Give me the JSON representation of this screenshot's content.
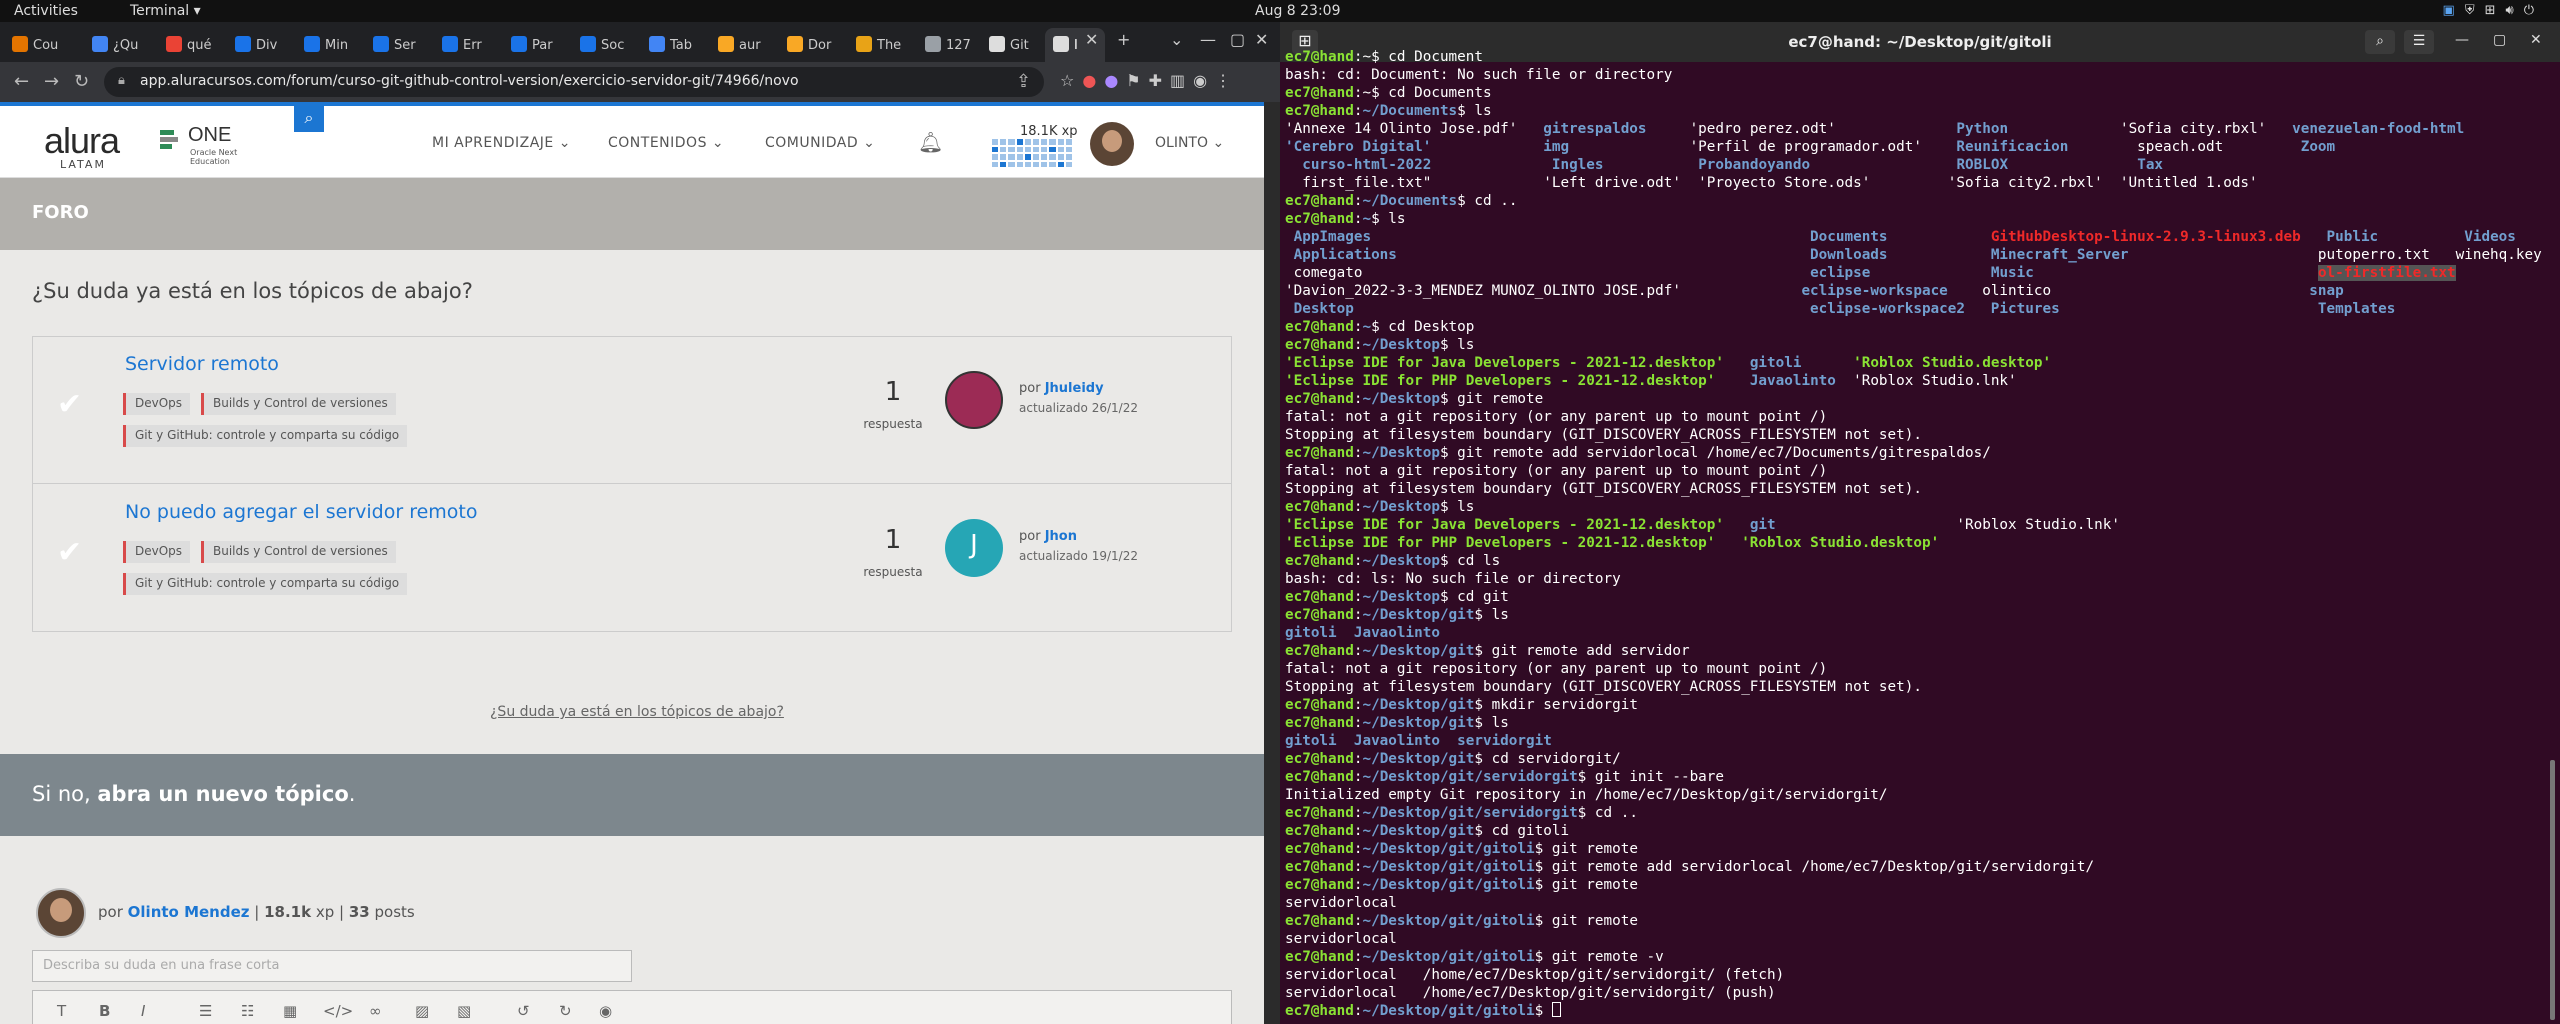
{
  "topbar": {
    "activities": "Activities",
    "app": "Terminal ▾",
    "clock": "Aug 8  23:09"
  },
  "browser": {
    "tabs": [
      {
        "label": "Cou",
        "color": "#e37400"
      },
      {
        "label": "¿Qu",
        "color": "#4285f4"
      },
      {
        "label": "qué",
        "color": "#ea4335"
      },
      {
        "label": "Div",
        "color": "#1a73e8"
      },
      {
        "label": "Min",
        "color": "#1a73e8"
      },
      {
        "label": "Ser",
        "color": "#1a73e8"
      },
      {
        "label": "Err",
        "color": "#1a73e8"
      },
      {
        "label": "Par",
        "color": "#1a73e8"
      },
      {
        "label": "Soc",
        "color": "#1a73e8"
      },
      {
        "label": "Tab",
        "color": "#4285f4"
      },
      {
        "label": "aur",
        "color": "#f9a825"
      },
      {
        "label": "Dor",
        "color": "#f9a825"
      },
      {
        "label": "The",
        "color": "#e8a317"
      },
      {
        "label": "127",
        "color": "#9aa0a6"
      },
      {
        "label": "Git",
        "color": "#ddd"
      },
      {
        "label": "I",
        "color": "#ddd"
      }
    ],
    "url": "app.aluracursos.com/forum/curso-git-github-control-version/exercicio-servidor-git/74966/novo"
  },
  "site": {
    "logo": "alura",
    "logo_sub": "LATAM",
    "one": "ONE",
    "one_sub": "Oracle Next Education",
    "menu": [
      "MI APRENDIZAJE ⌄",
      "CONTENIDOS ⌄",
      "COMUNIDAD ⌄"
    ],
    "xp": "18.1K xp",
    "user": "OLINTO ⌄",
    "foro": "FORO",
    "question": "¿Su duda ya está en los tópicos de abajo?",
    "topics": [
      {
        "title": "Servidor remoto",
        "tags": [
          "DevOps",
          "Builds y Control de versiones",
          "Git y GitHub: controle y comparta su código"
        ],
        "count": "1",
        "resp": "respuesta",
        "by": "Jhuleidy",
        "updated": "actualizado 26/1/22",
        "avatar_color": "#9c2b55"
      },
      {
        "title": "No puedo agregar el servidor remoto",
        "tags": [
          "DevOps",
          "Builds y Control de versiones",
          "Git y GitHub: controle y comparta su código"
        ],
        "count": "1",
        "resp": "respuesta",
        "by": "Jhon",
        "updated": "actualizado 19/1/22",
        "avatar_color": "#26a6b5",
        "initial": "J"
      }
    ],
    "por": "por",
    "dup_link": "¿Su duda ya está en los tópicos de abajo?",
    "new_prefix": "Si no, ",
    "new_bold": "abra un nuevo tópico",
    "new_suffix": ".",
    "composer_author": "Olinto Mendez",
    "composer_xp": "18.1k",
    "composer_xp_unit": "xp",
    "composer_posts": "33",
    "composer_posts_unit": "posts",
    "composer_placeholder": "Describa su duda en una frase corta"
  },
  "terminal": {
    "title": "ec7@hand: ~/Desktop/git/gitoli",
    "lines": [
      [
        [
          "p",
          "ec7@hand"
        ],
        [
          "",
          "~"
        ],
        [
          "",
          "$ cd Document"
        ]
      ],
      [
        [
          "",
          "bash: cd: Document: No such file or directory"
        ]
      ],
      [
        [
          "p",
          "ec7@hand"
        ],
        [
          "",
          "~"
        ],
        [
          "",
          "$ cd Documents"
        ]
      ],
      [
        [
          "p",
          "ec7@hand"
        ],
        [
          "pb",
          "~/Documents"
        ],
        [
          "",
          "$ ls"
        ]
      ],
      [
        [
          "",
          "'Annexe 14 Olinto Jose.pdf'   "
        ],
        [
          "d",
          "gitrespaldos"
        ],
        [
          "",
          "     'pedro perez.odt'              "
        ],
        [
          "d",
          "Python"
        ],
        [
          "",
          "             'Sofia city.rbxl'   "
        ],
        [
          "d",
          "venezuelan-food-html"
        ]
      ],
      [
        [
          "d",
          "'Cerebro Digital'"
        ],
        [
          "",
          "             "
        ],
        [
          "d",
          "img"
        ],
        [
          "",
          "              'Perfil de programador.odt'    "
        ],
        [
          "d",
          "Reunificacion"
        ],
        [
          "",
          "        speach.odt         "
        ],
        [
          "d",
          "Zoom"
        ]
      ],
      [
        [
          "",
          "  "
        ],
        [
          "d",
          "curso-html-2022"
        ],
        [
          "",
          "              "
        ],
        [
          "d",
          "Ingles"
        ],
        [
          "",
          "           "
        ],
        [
          "d",
          "Probandoyando"
        ],
        [
          "",
          "                 "
        ],
        [
          "d",
          "ROBLOX"
        ],
        [
          "",
          "               "
        ],
        [
          "d",
          "Tax"
        ]
      ],
      [
        [
          "",
          "  first_file.txt\"             'Left drive.odt'  'Proyecto Store.ods'         'Sofia city2.rbxl'  'Untitled 1.ods'"
        ]
      ],
      [
        [
          "p",
          "ec7@hand"
        ],
        [
          "pb",
          "~/Documents"
        ],
        [
          "",
          "$ cd .."
        ]
      ],
      [
        [
          "p",
          "ec7@hand"
        ],
        [
          "pb",
          "~"
        ],
        [
          "",
          "$ ls"
        ]
      ],
      [
        [
          "d",
          " AppImages                                                   Documents            "
        ],
        [
          "r",
          "GitHubDesktop-linux-2.9.3-linux3.deb"
        ],
        [
          "",
          "   "
        ],
        [
          "d",
          "Public"
        ],
        [
          "",
          "          "
        ],
        [
          "d",
          "Videos"
        ]
      ],
      [
        [
          "d",
          " Applications                                                Downloads            "
        ],
        [
          "d",
          "Minecraft_Server"
        ],
        [
          "",
          "                      putoperro.txt   winehq.key"
        ]
      ],
      [
        [
          "",
          "",
          " comegato                                                    "
        ],
        [
          "d",
          "eclipse"
        ],
        [
          "",
          "              "
        ],
        [
          "d",
          "Music"
        ],
        [
          "",
          "                                 "
        ],
        [
          "hl",
          "ol-firstfile.txt"
        ]
      ],
      [
        [
          "",
          "'Davion_2022-3-3_MENDEZ MUNOZ_OLINTO JOSE.pdf'              "
        ],
        [
          "d",
          "eclipse-workspace"
        ],
        [
          "",
          "    olintico                              "
        ],
        [
          "d",
          "snap"
        ]
      ],
      [
        [
          "d",
          " Desktop                                                     eclipse-workspace2   Pictures"
        ],
        [
          "",
          "                              "
        ],
        [
          "d",
          "Templates"
        ]
      ],
      [
        [
          "p",
          "ec7@hand"
        ],
        [
          "pb",
          "~"
        ],
        [
          "",
          "$ cd Desktop"
        ]
      ],
      [
        [
          "p",
          "ec7@hand"
        ],
        [
          "pb",
          "~/Desktop"
        ],
        [
          "",
          "$ ls"
        ]
      ],
      [
        [
          "o",
          "'Eclipse IDE for Java Developers - 2021-12.desktop'"
        ],
        [
          "",
          "   "
        ],
        [
          "d",
          "gitoli"
        ],
        [
          "",
          "      "
        ],
        [
          "o",
          "'Roblox Studio.desktop'"
        ]
      ],
      [
        [
          "o",
          "'Eclipse IDE for PHP Developers - 2021-12.desktop'"
        ],
        [
          "",
          "    "
        ],
        [
          "d",
          "Javaolinto"
        ],
        [
          "",
          "  'Roblox Studio.lnk'"
        ]
      ],
      [
        [
          "p",
          "ec7@hand"
        ],
        [
          "pb",
          "~/Desktop"
        ],
        [
          "",
          "$ git remote"
        ]
      ],
      [
        [
          "",
          "fatal: not a git repository (or any parent up to mount point /)"
        ]
      ],
      [
        [
          "",
          "Stopping at filesystem boundary (GIT_DISCOVERY_ACROSS_FILESYSTEM not set)."
        ]
      ],
      [
        [
          "p",
          "ec7@hand"
        ],
        [
          "pb",
          "~/Desktop"
        ],
        [
          "",
          "$ git remote add servidorlocal /home/ec7/Documents/gitrespaldos/"
        ]
      ],
      [
        [
          "",
          "fatal: not a git repository (or any parent up to mount point /)"
        ]
      ],
      [
        [
          "",
          "Stopping at filesystem boundary (GIT_DISCOVERY_ACROSS_FILESYSTEM not set)."
        ]
      ],
      [
        [
          "p",
          "ec7@hand"
        ],
        [
          "pb",
          "~/Desktop"
        ],
        [
          "",
          "$ ls"
        ]
      ],
      [
        [
          "o",
          "'Eclipse IDE for Java Developers - 2021-12.desktop'"
        ],
        [
          "",
          "   "
        ],
        [
          "d",
          "git"
        ],
        [
          "",
          "                     'Roblox Studio.lnk'"
        ]
      ],
      [
        [
          "o",
          "'Eclipse IDE for PHP Developers - 2021-12.desktop'"
        ],
        [
          "",
          "   "
        ],
        [
          "o",
          "'Roblox Studio.desktop'"
        ]
      ],
      [
        [
          "p",
          "ec7@hand"
        ],
        [
          "pb",
          "~/Desktop"
        ],
        [
          "",
          "$ cd ls"
        ]
      ],
      [
        [
          "",
          "bash: cd: ls: No such file or directory"
        ]
      ],
      [
        [
          "p",
          "ec7@hand"
        ],
        [
          "pb",
          "~/Desktop"
        ],
        [
          "",
          "$ cd git"
        ]
      ],
      [
        [
          "p",
          "ec7@hand"
        ],
        [
          "pb",
          "~/Desktop/git"
        ],
        [
          "",
          "$ ls"
        ]
      ],
      [
        [
          "d",
          "gitoli  Javaolinto"
        ]
      ],
      [
        [
          "p",
          "ec7@hand"
        ],
        [
          "pb",
          "~/Desktop/git"
        ],
        [
          "",
          "$ git remote add servidor"
        ]
      ],
      [
        [
          "",
          "fatal: not a git repository (or any parent up to mount point /)"
        ]
      ],
      [
        [
          "",
          "Stopping at filesystem boundary (GIT_DISCOVERY_ACROSS_FILESYSTEM not set)."
        ]
      ],
      [
        [
          "p",
          "ec7@hand"
        ],
        [
          "pb",
          "~/Desktop/git"
        ],
        [
          "",
          "$ mkdir servidorgit"
        ]
      ],
      [
        [
          "p",
          "ec7@hand"
        ],
        [
          "pb",
          "~/Desktop/git"
        ],
        [
          "",
          "$ ls"
        ]
      ],
      [
        [
          "d",
          "gitoli  Javaolinto  servidorgit"
        ]
      ],
      [
        [
          "p",
          "ec7@hand"
        ],
        [
          "pb",
          "~/Desktop/git"
        ],
        [
          "",
          "$ cd servidorgit/"
        ]
      ],
      [
        [
          "p",
          "ec7@hand"
        ],
        [
          "pb",
          "~/Desktop/git/servidorgit"
        ],
        [
          "",
          "$ git init --bare"
        ]
      ],
      [
        [
          "",
          "Initialized empty Git repository in /home/ec7/Desktop/git/servidorgit/"
        ]
      ],
      [
        [
          "p",
          "ec7@hand"
        ],
        [
          "pb",
          "~/Desktop/git/servidorgit"
        ],
        [
          "",
          "$ cd .."
        ]
      ],
      [
        [
          "p",
          "ec7@hand"
        ],
        [
          "pb",
          "~/Desktop/git"
        ],
        [
          "",
          "$ cd gitoli"
        ]
      ],
      [
        [
          "p",
          "ec7@hand"
        ],
        [
          "pb",
          "~/Desktop/git/gitoli"
        ],
        [
          "",
          "$ git remote"
        ]
      ],
      [
        [
          "p",
          "ec7@hand"
        ],
        [
          "pb",
          "~/Desktop/git/gitoli"
        ],
        [
          "",
          "$ git remote add servidorlocal /home/ec7/Desktop/git/servidorgit/"
        ]
      ],
      [
        [
          "p",
          "ec7@hand"
        ],
        [
          "pb",
          "~/Desktop/git/gitoli"
        ],
        [
          "",
          "$ git remote"
        ]
      ],
      [
        [
          "",
          "servidorlocal"
        ]
      ],
      [
        [
          "p",
          "ec7@hand"
        ],
        [
          "pb",
          "~/Desktop/git/gitoli"
        ],
        [
          "",
          "$ git remote"
        ]
      ],
      [
        [
          "",
          "servidorlocal"
        ]
      ],
      [
        [
          "p",
          "ec7@hand"
        ],
        [
          "pb",
          "~/Desktop/git/gitoli"
        ],
        [
          "",
          "$ git remote -v"
        ]
      ],
      [
        [
          "",
          "servidorlocal   /home/ec7/Desktop/git/servidorgit/ (fetch)"
        ]
      ],
      [
        [
          "",
          "servidorlocal   /home/ec7/Desktop/git/servidorgit/ (push)"
        ]
      ],
      [
        [
          "p",
          "ec7@hand"
        ],
        [
          "pb",
          "~/Desktop/git/gitoli"
        ],
        [
          "",
          "$ "
        ]
      ]
    ]
  }
}
